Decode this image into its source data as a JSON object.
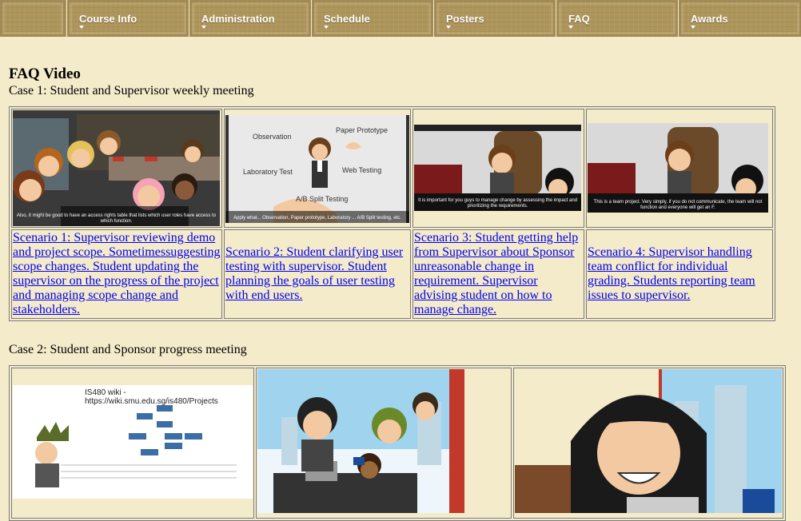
{
  "nav": {
    "items": [
      {
        "label": "Course Info"
      },
      {
        "label": "Administration"
      },
      {
        "label": "Schedule"
      },
      {
        "label": "Posters"
      },
      {
        "label": "FAQ"
      },
      {
        "label": "Awards"
      }
    ]
  },
  "main": {
    "title": "FAQ Video",
    "case1": {
      "title": "Case 1: Student and Supervisor weekly meeting",
      "scenarios": [
        {
          "text": "Scenario 1: Supervisor reviewing demo and project scope. Sometimessuggesting scope changes. Student updating the supervisor on the progress of the project and managing scope change and stakeholders.",
          "caption": "Also, it might be good to have an access rights table that lists which user roles have access to which function."
        },
        {
          "text": "Scenario 2: Student clarifying user testing with supervisor. Student planning the goals of user testing with end users.",
          "labels": [
            "Observation",
            "Paper Prototype",
            "Laboratory Test",
            "Web Testing",
            "A/B Split Testing"
          ],
          "caption": "Apply what... Observation, Paper prototype, Laboratory ... A/B Split testing, etc."
        },
        {
          "text": "Scenario 3: Student getting help from Supervisor about Sponsor unreasonable change in requirement. Supervisor advising student on how to manage change.",
          "caption": "It is important for you guys to manage change by assessing the impact and prioritizing the requirements."
        },
        {
          "text": "Scenario 4: Supervisor handling team conflict for individual grading. Students reporting team issues to supervisor.",
          "caption": "This is a team project. Very simply, if you do not communicate, the team will not function and everyone will get an F."
        }
      ]
    },
    "case2": {
      "title": "Case 2: Student and Sponsor progress meeting",
      "thumbs": [
        {
          "heading": "IS480 wiki - https://wiki.smu.edu.sg/is480/Projects"
        },
        {},
        {}
      ]
    }
  },
  "colors": {
    "page_bg": "#f4ebcb",
    "nav_bg": "#ad955b",
    "link": "#0000ee"
  }
}
